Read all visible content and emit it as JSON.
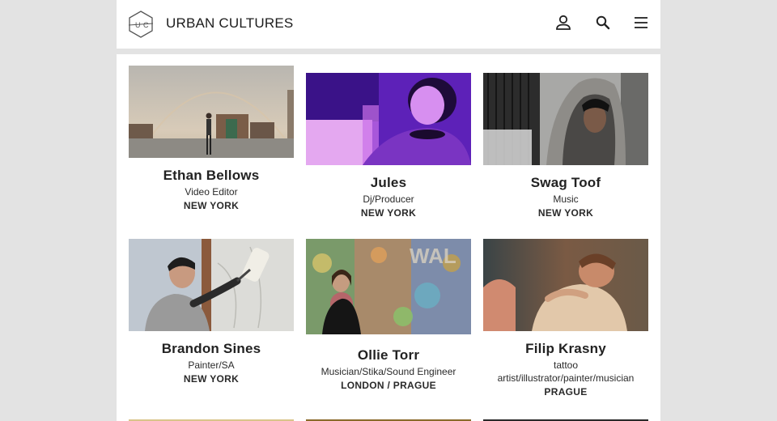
{
  "header": {
    "brand": "URBAN CULTURES",
    "logo_letters": "U C",
    "icons": [
      "user-icon",
      "search-icon",
      "menu-icon"
    ]
  },
  "artists": [
    {
      "name": "Ethan Bellows",
      "roles": [
        "Video Editor"
      ],
      "city": "NEW YORK"
    },
    {
      "name": "Jules",
      "roles": [
        "Dj/Producer"
      ],
      "city": "NEW YORK"
    },
    {
      "name": "Swag Toof",
      "roles": [
        "Music"
      ],
      "city": "NEW YORK"
    },
    {
      "name": "Brandon Sines",
      "roles": [
        "Painter/SA"
      ],
      "city": "NEW YORK"
    },
    {
      "name": "Ollie Torr",
      "roles": [
        "Musician/Stika/Sound Engineer"
      ],
      "city": "LONDON / PRAGUE"
    },
    {
      "name": "Filip Krasny",
      "roles": [
        "tattoo",
        "artist/illustrator/painter/musician"
      ],
      "city": "PRAGUE"
    }
  ],
  "colors": {
    "background": "#e3e3e3",
    "panel": "#ffffff",
    "text": "#222222"
  }
}
